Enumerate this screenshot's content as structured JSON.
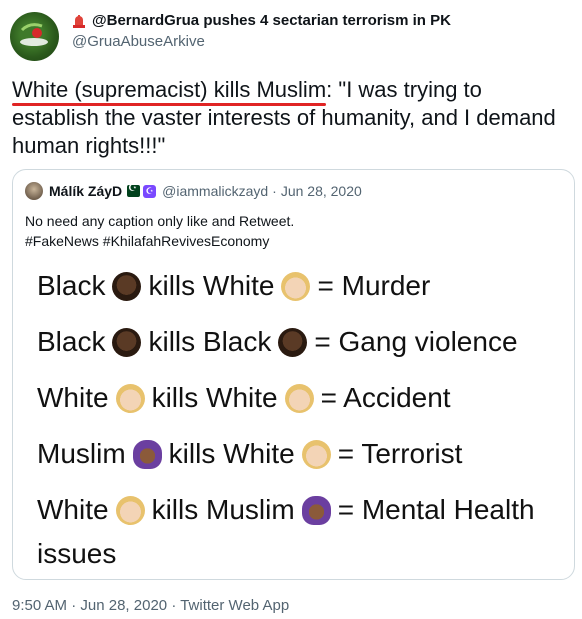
{
  "author": {
    "display_name": "@BernardGrua pushes 4 sectarian terrorism in PK",
    "handle": "@GruaAbuseArkive",
    "icons": [
      "siren-icon"
    ]
  },
  "tweet": {
    "underlined_text": "White (supremacist) kills Muslim",
    "text_rest": ": \"I was trying to establish the vaster interests of humanity, and I demand human rights!!!\""
  },
  "quoted": {
    "name": "Málík ZáyD",
    "handle": "@iammalickzayd",
    "separator": "·",
    "date": "Jun 28, 2020",
    "icons": [
      "pakistan-flag-icon",
      "crescent-badge-icon"
    ],
    "text_line1": "No need any caption only like and Retweet.",
    "text_line2": "#FakeNews #KhilafahRevivesEconomy",
    "meme": [
      {
        "a": "Black",
        "emoji_a": "black-man-emoji",
        "b": "kills White",
        "emoji_b": "white-man-emoji",
        "c": "= Murder"
      },
      {
        "a": "Black",
        "emoji_a": "black-man-emoji",
        "b": "kills Black",
        "emoji_b": "black-man-emoji",
        "c": "= Gang violence"
      },
      {
        "a": "White",
        "emoji_a": "white-man-emoji",
        "b": "kills White",
        "emoji_b": "white-man-emoji",
        "c": "= Accident"
      },
      {
        "a": "Muslim",
        "emoji_a": "hijab-woman-emoji",
        "b": "kills White",
        "emoji_b": "white-man-emoji",
        "c": "= Terrorist"
      },
      {
        "a": "White",
        "emoji_a": "white-man-emoji",
        "b": "kills Muslim",
        "emoji_b": "hijab-woman-emoji",
        "c": "= Mental Health"
      }
    ],
    "meme_last_line": "issues"
  },
  "footer": {
    "time": "9:50 AM",
    "sep1": "·",
    "date": "Jun 28, 2020",
    "sep2": "·",
    "source": "Twitter Web App"
  }
}
